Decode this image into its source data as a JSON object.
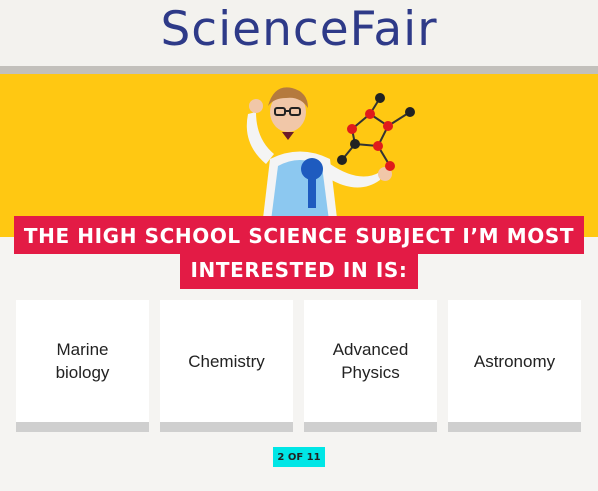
{
  "hero": {
    "sign_text": "ScienceFair",
    "image_description": "student-with-molecule-model"
  },
  "question": {
    "title_line1": "THE HIGH SCHOOL SCIENCE SUBJECT I’M MOST",
    "title_line2": "INTERESTED IN IS:"
  },
  "answers": [
    {
      "label": "Marine biology"
    },
    {
      "label": "Chemistry"
    },
    {
      "label": "Advanced Physics"
    },
    {
      "label": "Astronomy"
    }
  ],
  "progress": {
    "label": "2 OF 11"
  },
  "colors": {
    "title_bg": "#e31b45",
    "progress_bg": "#00e6e6",
    "hero_yellow": "#ffc812",
    "sign_text": "#2e3a88"
  }
}
